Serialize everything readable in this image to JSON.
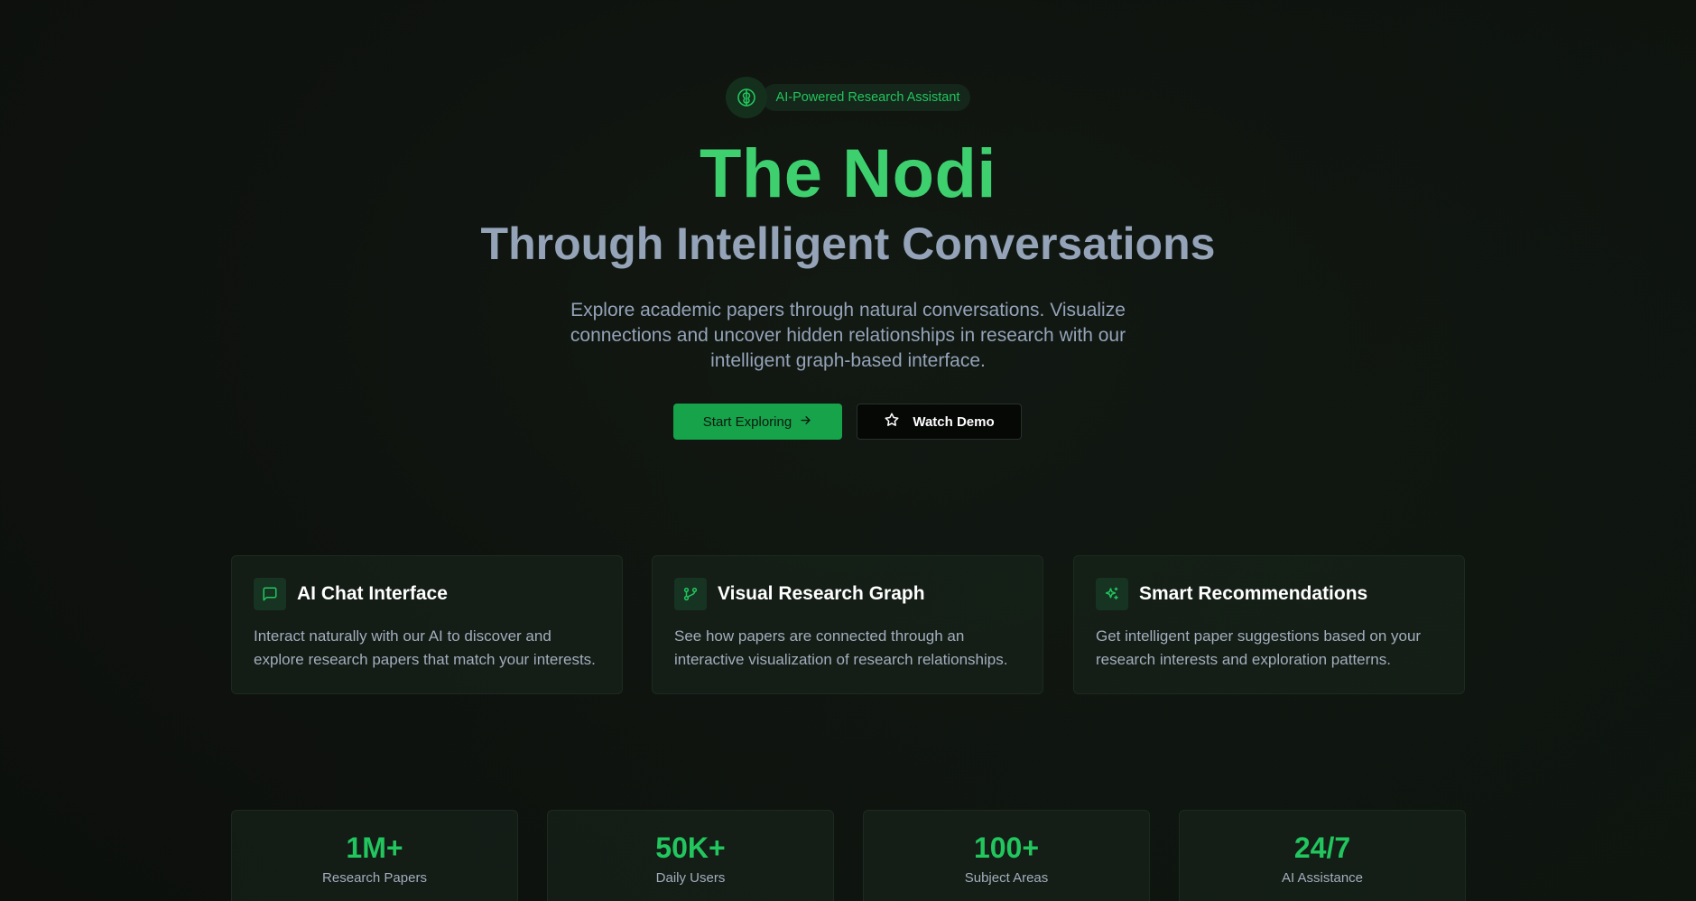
{
  "badge": {
    "icon": "brain-icon",
    "label": "AI-Powered Research Assistant"
  },
  "hero": {
    "title": "The Nodi",
    "subtitle": "Through Intelligent Conversations",
    "description": "Explore academic papers through natural conversations. Visualize connections and uncover hidden relationships in research with our intelligent graph-based interface."
  },
  "buttons": {
    "primary": {
      "label": "Start Exploring",
      "icon": "arrow-right-icon"
    },
    "secondary": {
      "label": "Watch Demo",
      "icon": "star-icon"
    }
  },
  "features": [
    {
      "icon": "message-square-icon",
      "title": "AI Chat Interface",
      "text": "Interact naturally with our AI to discover and explore research papers that match your interests."
    },
    {
      "icon": "git-compare-icon",
      "title": "Visual Research Graph",
      "text": "See how papers are connected through an interactive visualization of research relationships."
    },
    {
      "icon": "sparkles-icon",
      "title": "Smart Recommendations",
      "text": "Get intelligent paper suggestions based on your research interests and exploration patterns."
    }
  ],
  "stats": [
    {
      "value": "1M+",
      "label": "Research Papers"
    },
    {
      "value": "50K+",
      "label": "Daily Users"
    },
    {
      "value": "100+",
      "label": "Subject Areas"
    },
    {
      "value": "24/7",
      "label": "AI Assistance"
    }
  ],
  "colors": {
    "accent": "#22c55e",
    "title": "#3ecf6e",
    "muted": "#94a3b8",
    "primary_button": "#16a34a",
    "background": "#0f130f"
  }
}
